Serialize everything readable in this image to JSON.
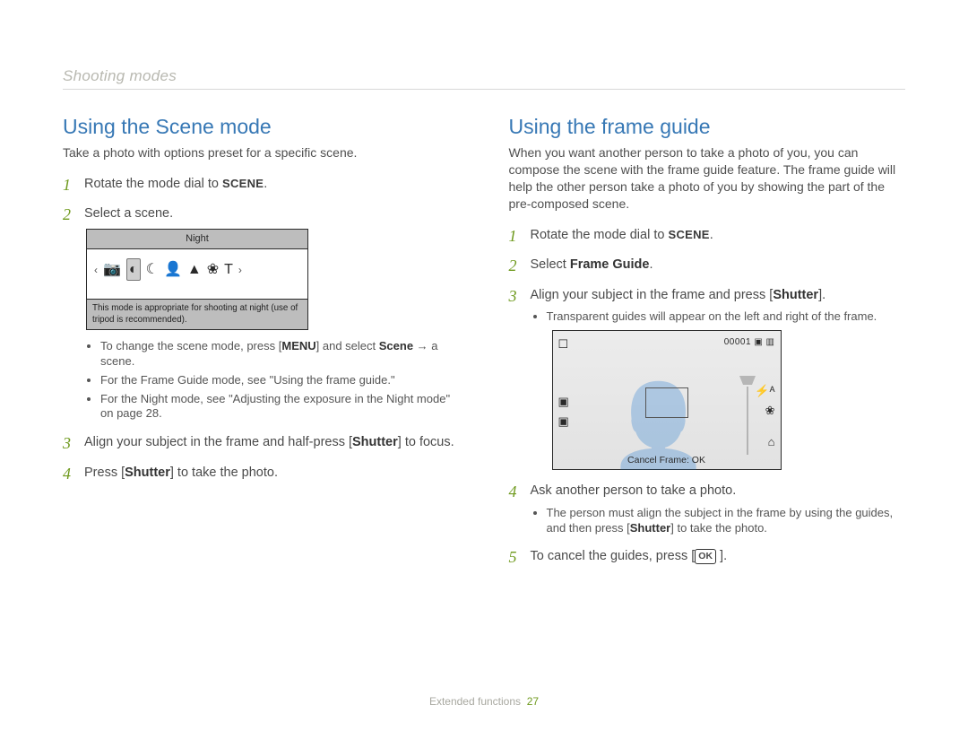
{
  "sectionLabel": "Shooting modes",
  "footer": {
    "text": "Extended functions",
    "page": "27"
  },
  "left": {
    "heading": "Using the Scene mode",
    "intro": "Take a photo with options preset for a specific scene.",
    "step1_pre": "Rotate the mode dial to ",
    "step1_scene": "SCENE",
    "step1_post": ".",
    "step2": "Select a scene.",
    "lcd": {
      "topBar": "Night",
      "desc": "This mode is appropriate for shooting at night (use of tripod is recommended).",
      "icons": {
        "leftChevron": "‹",
        "i1": "📷",
        "sel": "◐",
        "i3": "☾",
        "i4": "👤",
        "i5": "▲",
        "i6": "❀",
        "i7": "T",
        "rightChevron": "›"
      }
    },
    "sub1_pre": "To change the scene mode, press [",
    "sub1_menu": "MENU",
    "sub1_mid": "] and select ",
    "sub1_scene": "Scene",
    "sub1_post": " → a scene.",
    "sub2": "For the Frame Guide mode, see \"Using the frame guide.\"",
    "sub3": "For the Night mode, see \"Adjusting the exposure in the Night mode\" on page 28.",
    "step3_pre": "Align your subject in the frame and half-press [",
    "step3_shutter": "Shutter",
    "step3_post": "] to focus.",
    "step4_pre": "Press [",
    "step4_shutter": "Shutter",
    "step4_post": "] to take the photo."
  },
  "right": {
    "heading": "Using the frame guide",
    "intro": "When you want another person to take a photo of you, you can compose the scene with the frame guide feature. The frame guide will help the other person take a photo of you by showing the part of the pre-composed scene.",
    "step1_pre": "Rotate the mode dial to ",
    "step1_scene": "SCENE",
    "step1_post": ".",
    "step2_pre": "Select ",
    "step2_bold": "Frame Guide",
    "step2_post": ".",
    "step3_pre": "Align your subject in the frame and press [",
    "step3_shutter": "Shutter",
    "step3_post": "].",
    "sub3a": "Transparent guides will appear on the left and right of the frame.",
    "lcd": {
      "topLeft": "☐",
      "topRight": "00001 ▣ ▥",
      "midLeft1": "▣",
      "midLeft2": "▣",
      "midRight1": "⚡ᴬ",
      "midRight2": "❀",
      "bottomRightIcon": "⌂",
      "bottom": "Cancel Frame: OK"
    },
    "step4": "Ask another person to take a photo.",
    "sub4_pre": "The person must align the subject in the frame by using the guides, and then press [",
    "sub4_shutter": "Shutter",
    "sub4_post": "] to take the photo.",
    "step5_pre": "To cancel the guides, press [",
    "step5_ok": "OK",
    "step5_post": " ]."
  }
}
